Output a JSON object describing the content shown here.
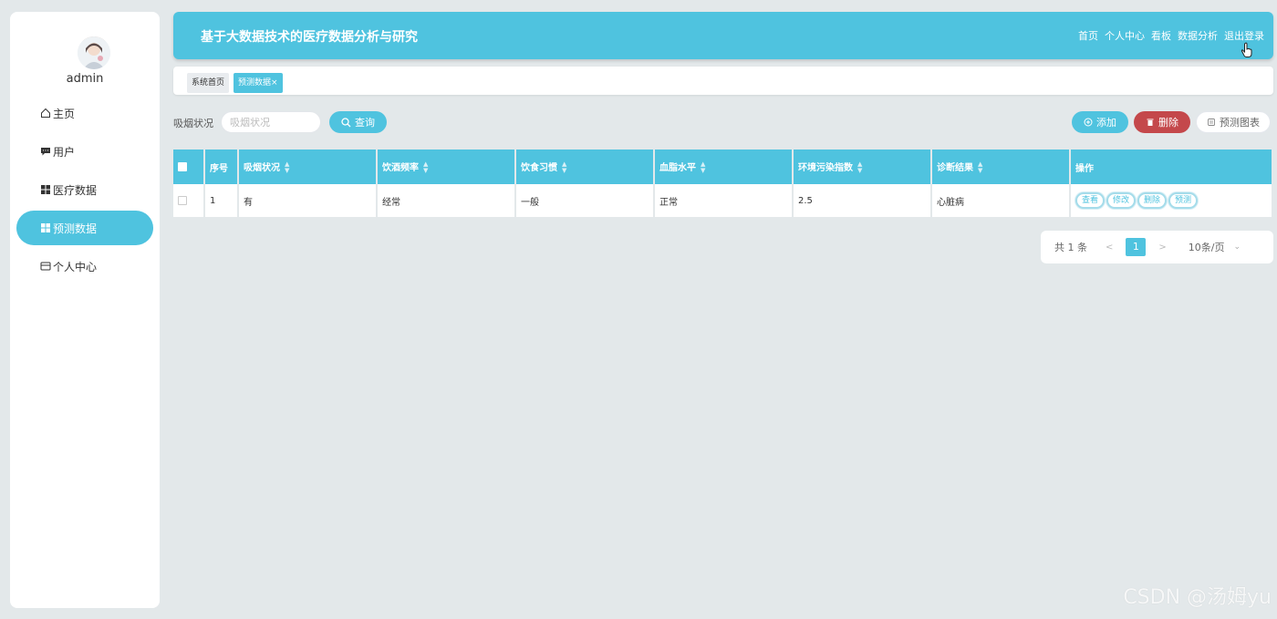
{
  "sidebar": {
    "username": "admin",
    "items": [
      {
        "label": "主页",
        "icon": "home-icon"
      },
      {
        "label": "用户",
        "icon": "chat-icon"
      },
      {
        "label": "医疗数据",
        "icon": "grid-icon"
      },
      {
        "label": "预测数据",
        "icon": "grid-icon",
        "active": true
      },
      {
        "label": "个人中心",
        "icon": "card-icon"
      }
    ]
  },
  "header": {
    "title": "基于大数据技术的医疗数据分析与研究",
    "nav": [
      "首页",
      "个人中心",
      "看板",
      "数据分析",
      "退出登录"
    ]
  },
  "tabs": [
    {
      "label": "系统首页"
    },
    {
      "label": "预测数据×"
    }
  ],
  "search": {
    "label": "吸烟状况",
    "placeholder": "吸烟状况",
    "query_label": "查询"
  },
  "actions": {
    "add_label": "添加",
    "delete_label": "删除",
    "chart_label": "预测图表"
  },
  "table": {
    "headers": [
      "序号",
      "吸烟状况",
      "饮酒频率",
      "饮食习惯",
      "血脂水平",
      "环境污染指数",
      "诊断结果",
      "操作"
    ],
    "rows": [
      {
        "index": "1",
        "smoking": "有",
        "drinking": "经常",
        "diet": "一般",
        "lipid": "正常",
        "pollution": "2.5",
        "diagnosis": "心脏病"
      }
    ],
    "row_actions": [
      "查看",
      "修改",
      "删除",
      "预测"
    ]
  },
  "pagination": {
    "total": "共 1 条",
    "current": "1",
    "page_size": "10条/页"
  },
  "watermark": "CSDN @汤姆yu"
}
